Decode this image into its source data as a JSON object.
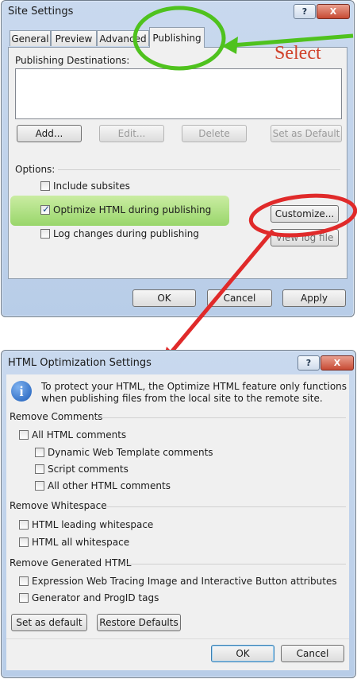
{
  "site_settings": {
    "title": "Site Settings",
    "help_label": "?",
    "close_label": "X",
    "tabs": [
      "General",
      "Preview",
      "Advanced",
      "Publishing"
    ],
    "publishing_destinations_label": "Publishing Destinations:",
    "buttons": {
      "add": "Add...",
      "edit": "Edit...",
      "delete": "Delete",
      "set_default": "Set as Default"
    },
    "options_label": "Options:",
    "options": [
      {
        "label": "Include subsites",
        "checked": false
      },
      {
        "label": "Optimize HTML during publishing",
        "checked": true
      },
      {
        "label": "Log changes during publishing",
        "checked": false
      }
    ],
    "customize_label": "Customize...",
    "view_log_label": "View log file",
    "ok_label": "OK",
    "cancel_label": "Cancel",
    "apply_label": "Apply"
  },
  "annotation": {
    "select_text": "Select"
  },
  "html_optimization": {
    "title": "HTML Optimization Settings",
    "help_label": "?",
    "close_label": "X",
    "info_text": "To protect your HTML, the Optimize HTML feature only functions when publishing files from the local site to the remote site.",
    "remove_comments": {
      "heading": "Remove Comments",
      "all": "All HTML comments",
      "items": [
        "Dynamic Web Template comments",
        "Script comments",
        "All other HTML comments"
      ]
    },
    "remove_whitespace": {
      "heading": "Remove Whitespace",
      "items": [
        "HTML leading whitespace",
        "HTML all whitespace"
      ]
    },
    "remove_generated": {
      "heading": "Remove Generated HTML",
      "items": [
        "Expression Web Tracing Image and Interactive Button attributes",
        "Generator and ProgID tags"
      ]
    },
    "set_as_default_label": "Set as default",
    "restore_defaults_label": "Restore Defaults",
    "ok_label": "OK",
    "cancel_label": "Cancel"
  },
  "colors": {
    "annotation_green": "#4fc21e",
    "annotation_red": "#e02a2a",
    "select_text": "#d0412a",
    "info_blue": "#1c5cb8"
  }
}
